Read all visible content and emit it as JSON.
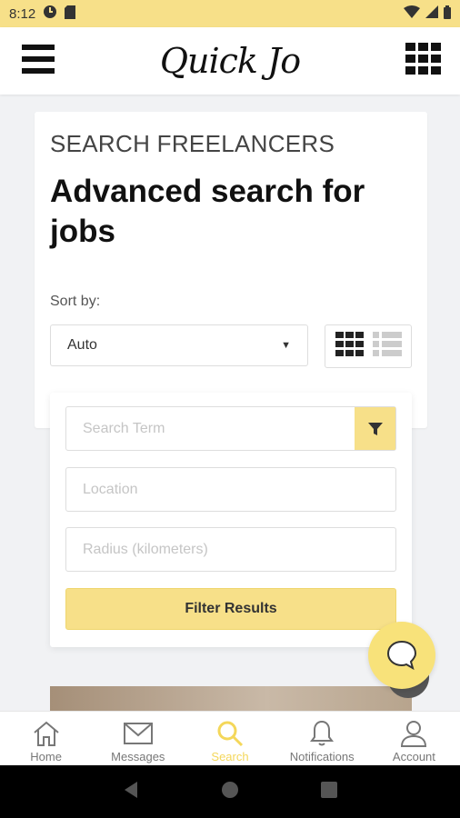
{
  "status_bar": {
    "time": "8:12"
  },
  "app_bar": {
    "logo_text": "Quick Jo"
  },
  "search_card": {
    "overline": "SEARCH FREELANCERS",
    "title": "Advanced search for jobs",
    "sort_label": "Sort by:",
    "sort_value": "Auto"
  },
  "filters": {
    "search_term_placeholder": "Search Term",
    "location_placeholder": "Location",
    "radius_placeholder": "Radius (kilometers)",
    "filter_button_label": "Filter Results"
  },
  "bottom_nav": {
    "items": [
      {
        "label": "Home",
        "icon": "home-icon",
        "active": false
      },
      {
        "label": "Messages",
        "icon": "mail-icon",
        "active": false
      },
      {
        "label": "Search",
        "icon": "search-icon",
        "active": true
      },
      {
        "label": "Notifications",
        "icon": "bell-icon",
        "active": false
      },
      {
        "label": "Account",
        "icon": "user-icon",
        "active": false
      }
    ]
  },
  "colors": {
    "accent": "#f7e089",
    "active_nav": "#f4d75a",
    "background": "#f1f2f4"
  }
}
